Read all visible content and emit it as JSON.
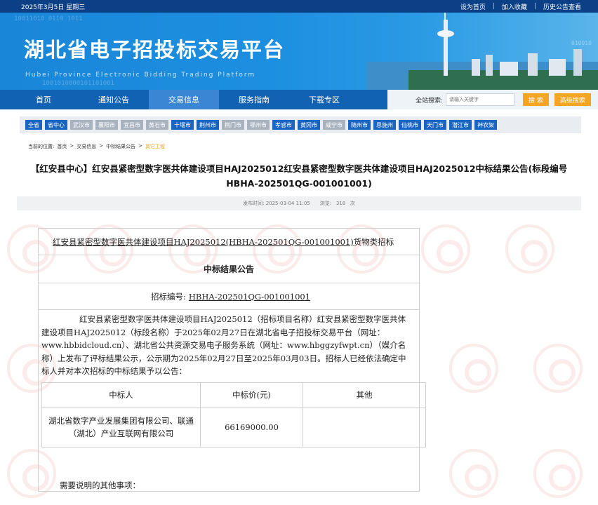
{
  "topbar": {
    "date": "2025年3月5日 星期三",
    "links": [
      "设为首页",
      "加入收藏",
      "历史公告查看"
    ]
  },
  "banner": {
    "title": "湖北省电子招投标交易平台",
    "subtitle": "Hubei Province Electronic Bidding Trading Platform"
  },
  "nav": {
    "items": [
      "首页",
      "通知公告",
      "交易信息",
      "服务指南",
      "下载专区"
    ],
    "active_index": 2
  },
  "search": {
    "label": "全站搜索:",
    "placeholder": "请输入关键字",
    "search_button": "搜 索",
    "advanced_button": "高级搜索"
  },
  "regions": [
    {
      "name": "全省",
      "enabled": true
    },
    {
      "name": "省中心",
      "enabled": true
    },
    {
      "name": "武汉市",
      "enabled": false
    },
    {
      "name": "襄阳市",
      "enabled": false
    },
    {
      "name": "宜昌市",
      "enabled": false
    },
    {
      "name": "黄石市",
      "enabled": false
    },
    {
      "name": "十堰市",
      "enabled": true
    },
    {
      "name": "荆州市",
      "enabled": true
    },
    {
      "name": "荆门市",
      "enabled": false
    },
    {
      "name": "鄂州市",
      "enabled": false
    },
    {
      "name": "孝感市",
      "enabled": true
    },
    {
      "name": "黄冈市",
      "enabled": true
    },
    {
      "name": "咸宁市",
      "enabled": false
    },
    {
      "name": "随州市",
      "enabled": true
    },
    {
      "name": "恩施州",
      "enabled": true
    },
    {
      "name": "仙桃市",
      "enabled": true
    },
    {
      "name": "天门市",
      "enabled": true
    },
    {
      "name": "潜江市",
      "enabled": true
    },
    {
      "name": "神农架",
      "enabled": true
    }
  ],
  "breadcrumb": {
    "prefix": "当前的位置:",
    "items": [
      "首页",
      "交易信息",
      "中标结果公告"
    ],
    "current": "其它工程"
  },
  "article": {
    "title": "【红安县中心】红安县紧密型数字医共体建设项目HAJ2025012红安县紧密型数字医共体建设项目HAJ2025012中标结果公告(标段编号HBHA-202501QG-001001001)",
    "publish_label": "发布时间:",
    "publish_time": "2025-03-04 11:05",
    "views_label": "浏览:",
    "views": "318",
    "views_unit": "次"
  },
  "doc": {
    "project_line_underlined": "红安县紧密型数字医共体建设项目HAJ2025012(HBHA-202501QG-001001001)",
    "project_line_suffix": "货物类招标",
    "heading": "中标结果公告",
    "bid_no_label": "招标编号:",
    "bid_no": "HBHA-202501QG-001001001",
    "paragraph": "红安县紧密型数字医共体建设项目HAJ2025012（招标项目名称）红安县紧密型数字医共体建设项目HAJ2025012（标段名称）于2025年02月27日在湖北省电子招投标交易平台（网址：www.hbbidcloud.cn）、湖北省公共资源交易电子服务系统（网址：www.hbggzyfwpt.cn）（媒介名称）上发布了评标结果公示，公示期为2025年02月27日至2025年03月03日。招标人已经依法确定中标人并对本次招标的中标结果予以公告：",
    "table": {
      "headers": [
        "中标人",
        "中标价(元)",
        "其他"
      ],
      "rows": [
        [
          "湖北省数字产业发展集团有限公司、联通（湖北）产业互联网有限公司",
          "66169000.00",
          ""
        ]
      ]
    },
    "note": "需要说明的其他事项："
  }
}
